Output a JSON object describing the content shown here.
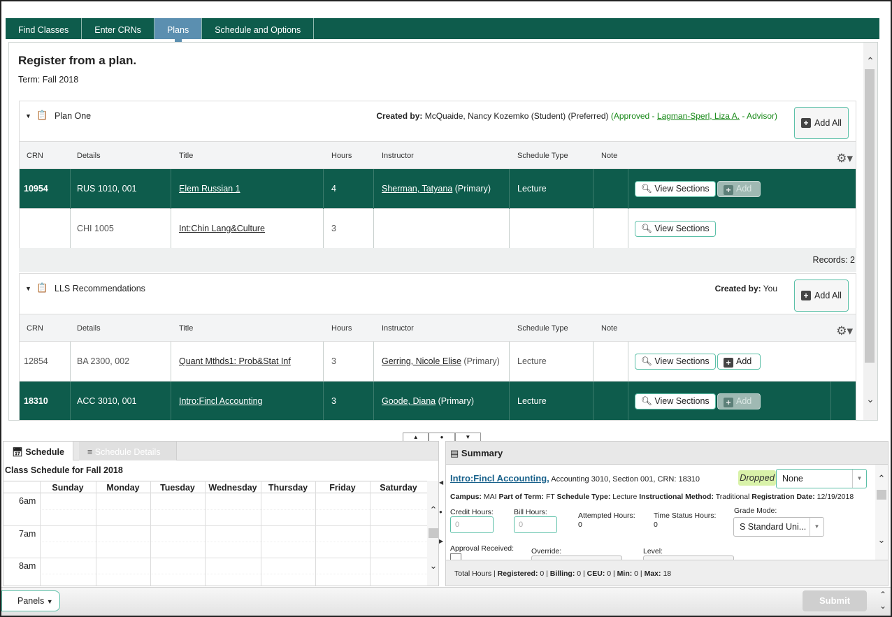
{
  "nav": {
    "tabs": [
      {
        "label": "Find Classes"
      },
      {
        "label": "Enter CRNs"
      },
      {
        "label": "Plans"
      },
      {
        "label": "Schedule and Options"
      }
    ],
    "active_index": 2
  },
  "main": {
    "heading": "Register from a plan.",
    "term": "Term: Fall 2018"
  },
  "columns": {
    "crn": "CRN",
    "details": "Details",
    "title": "Title",
    "hours": "Hours",
    "instructor": "Instructor",
    "schedule_type": "Schedule Type",
    "note": "Note"
  },
  "plans": [
    {
      "name": "Plan One",
      "created_label": "Created by:",
      "created_by": "McQuaide, Nancy Kozemko (Student) (Preferred)",
      "approved_prefix": "(Approved -",
      "approved_advisor": "Lagman-Sperl, Liza A.",
      "approved_suffix": "- Advisor)",
      "add_all_label": "Add All",
      "rows": [
        {
          "crn": "10954",
          "details": "RUS 1010, 001",
          "title": "Elem Russian 1",
          "hours": "4",
          "instructor": "Sherman, Tatyana",
          "instructor_role": "(Primary)",
          "schedule_type": "Lecture",
          "view_label": "View Sections",
          "add_label": "Add"
        },
        {
          "crn": "",
          "details": "CHI 1005",
          "title": "Int:Chin Lang&Culture",
          "hours": "3",
          "instructor": "",
          "instructor_role": "",
          "schedule_type": "",
          "view_label": "View Sections",
          "add_label": ""
        }
      ],
      "records": "Records: 2"
    },
    {
      "name": "LLS Recommendations",
      "created_label": "Created by:",
      "created_by": "You",
      "add_all_label": "Add All",
      "rows": [
        {
          "crn": "12854",
          "details": "BA 2300, 002",
          "title": "Quant Mthds1: Prob&Stat Inf",
          "hours": "3",
          "instructor": "Gerring, Nicole Elise",
          "instructor_role": "(Primary)",
          "schedule_type": "Lecture",
          "view_label": "View Sections",
          "add_label": "Add"
        },
        {
          "crn": "18310",
          "details": "ACC 3010, 001",
          "title": "Intro:Fincl Accounting",
          "hours": "3",
          "instructor": "Goode, Diana",
          "instructor_role": "(Primary)",
          "schedule_type": "Lecture",
          "view_label": "View Sections",
          "add_label": "Add"
        }
      ]
    }
  ],
  "schedule": {
    "tab_schedule": "Schedule",
    "tab_details": "Schedule Details",
    "heading": "Class Schedule for Fall 2018",
    "days": [
      "Sunday",
      "Monday",
      "Tuesday",
      "Wednesday",
      "Thursday",
      "Friday",
      "Saturday"
    ],
    "times": [
      "6am",
      "7am",
      "8am"
    ]
  },
  "summary": {
    "heading": "Summary",
    "course_link": "Intro:Fincl Accounting,",
    "course_info": "Accounting 3010, Section 001, CRN: 18310",
    "status": "Dropped",
    "action_value": "None",
    "campus_label": "Campus:",
    "campus": "MAI",
    "part_label": "Part of Term:",
    "part": "FT",
    "stype_label": "Schedule Type:",
    "stype": "Lecture",
    "method_label": "Instructional Method:",
    "method": "Traditional",
    "regdate_label": "Registration Date:",
    "regdate": "12/19/2018",
    "credit_hours_label": "Credit Hours:",
    "credit_hours": "0",
    "bill_hours_label": "Bill Hours:",
    "bill_hours": "0",
    "attempted_label": "Attempted Hours:",
    "attempted": "0",
    "time_status_label": "Time Status Hours:",
    "time_status": "0",
    "grade_mode_label": "Grade Mode:",
    "grade_mode": "S Standard Uni...",
    "approval_label": "Approval Received:",
    "override_label": "Override:",
    "level_label": "Level:",
    "footer": {
      "total_label": "Total Hours |",
      "registered_label": "Registered:",
      "registered": "0",
      "billing_label": "Billing:",
      "billing": "0",
      "ceu_label": "CEU:",
      "ceu": "0",
      "min_label": "Min:",
      "min": "0",
      "max_label": "Max:",
      "max": "18"
    }
  },
  "footer": {
    "panels_label": "Panels",
    "submit_label": "Submit"
  },
  "colors": {
    "brand_green": "#0e5c4c",
    "active_tab": "#5b8fb0",
    "accent_border": "#5cc0a8",
    "dropped_badge": "#d9f2a9",
    "approved_text": "#1a8a1a",
    "link_blue": "#17608a"
  },
  "icons": {
    "gear": "gear-icon",
    "clipboard": "clipboard-icon",
    "search": "search-icon",
    "plus": "plus-icon",
    "calendar": "calendar-icon",
    "list": "list-icon",
    "summary": "summary-icon"
  }
}
